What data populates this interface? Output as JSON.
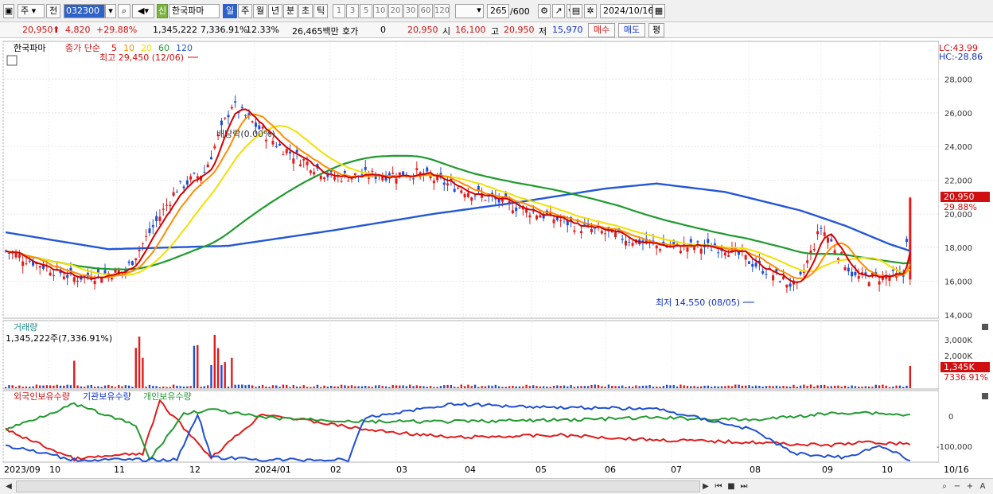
{
  "toolbar": {
    "type_label": "주",
    "all_label": "전",
    "code": "032300",
    "badge": "신",
    "name": "한국파마",
    "periods": [
      "일",
      "주",
      "월",
      "년",
      "분",
      "초",
      "틱"
    ],
    "selected_period": "일",
    "intervals": [
      "1",
      "3",
      "5",
      "10",
      "20",
      "30",
      "60",
      "120"
    ],
    "count": "265",
    "total": "/600",
    "date": "2024/10/16"
  },
  "quote": {
    "price": "20,950",
    "change": "4,820",
    "change_pct": "+29.88%",
    "volume": "1,345,222",
    "vol_pct": "7,336.91%",
    "turnover": "12.33%",
    "amount": "26,465백만",
    "hoga_label": "호가",
    "hoga_val": "0",
    "hoga_price": "20,950",
    "open_label": "시",
    "open": "16,100",
    "high_label": "고",
    "high": "20,950",
    "low_label": "저",
    "low": "15,970",
    "buy_label": "매수",
    "sell_label": "매도",
    "eval_label": "평"
  },
  "price_panel": {
    "name": "한국파마",
    "ma_title": "종가 단순",
    "ma_periods": [
      "5",
      "10",
      "20",
      "60",
      "120"
    ],
    "max_label": "최고 29,450 (12/06)",
    "min_label": "최저 14,550 (08/05)",
    "rights_label": "배당락(0.00%)",
    "lc": "LC:43.99",
    "hc": "HC:-28.86",
    "yticks": [
      "28,000",
      "26,000",
      "24,000",
      "22,000",
      "20,000",
      "18,000",
      "16,000",
      "14,000"
    ],
    "last_price": "20,950",
    "last_pct": "29.88%"
  },
  "volume_panel": {
    "title": "거래량",
    "value": "1,345,222주(7,336.91%)",
    "yticks": [
      "3,000K",
      "2,000K"
    ],
    "last_value": "1,345K",
    "last_pct": "7336.91%"
  },
  "holdings_panel": {
    "series": [
      "외국인보유수량",
      "기관보유수량",
      "개인보유수량"
    ],
    "yticks": [
      "0",
      "-100,000"
    ]
  },
  "xaxis": [
    "2023/09",
    "10",
    "11",
    "12",
    "2024/01",
    "02",
    "03",
    "04",
    "05",
    "06",
    "07",
    "08",
    "09",
    "10",
    "10/16"
  ],
  "colors": {
    "ma5": "#d40000",
    "ma10": "#ff8c00",
    "ma20": "#f2e000",
    "ma60": "#1f9a2e",
    "ma120": "#2457d6",
    "up": "#e11b1b",
    "down": "#1f4fd0"
  },
  "chart_data": {
    "type": "line",
    "title": "한국파마",
    "ylabel": "",
    "ylim": [
      13800,
      30200
    ],
    "series": [
      {
        "name": "종가 단순 5",
        "x": [
          "2023/09",
          "2023/10",
          "2023/11",
          "2023/11",
          "2023/12",
          "2023/12",
          "2024/01",
          "2024/02",
          "2024/03",
          "2024/04",
          "2024/05",
          "2024/06",
          "2024/07",
          "2024/08",
          "2024/08",
          "2024/09",
          "2024/10",
          "2024/10/16"
        ],
        "y": [
          17800,
          16200,
          16600,
          21500,
          22500,
          26500,
          24000,
          22200,
          22400,
          21000,
          19100,
          18100,
          18000,
          15600,
          19200,
          16200,
          16300,
          17200
        ]
      },
      {
        "name": "종가 단순 120",
        "x": [
          "2023/09",
          "2023/11",
          "2023/12",
          "2024/01",
          "2024/02",
          "2024/03",
          "2024/04",
          "2024/05",
          "2024/06",
          "2024/07",
          "2024/08",
          "2024/09",
          "2024/10",
          "2024/10/16"
        ],
        "y": [
          18900,
          17900,
          18100,
          19000,
          20000,
          20700,
          21500,
          21800,
          21300,
          20700,
          20100,
          19300,
          18200,
          17800
        ]
      }
    ]
  }
}
